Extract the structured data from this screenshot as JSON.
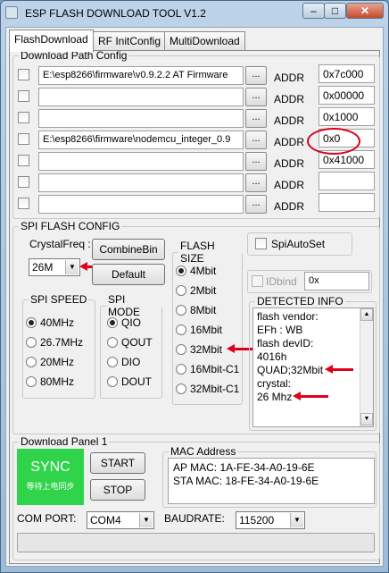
{
  "window": {
    "title": "ESP FLASH DOWNLOAD TOOL V1.2",
    "minimize": "–",
    "maximize": "□",
    "close": "✕"
  },
  "tabs": [
    {
      "label": "FlashDownload",
      "active": true
    },
    {
      "label": "RF InitConfig",
      "active": false
    },
    {
      "label": "MultiDownload",
      "active": false
    }
  ],
  "download_path_config": {
    "legend": "Download Path Config",
    "browse_label": "...",
    "addr_label": "ADDR",
    "rows": [
      {
        "checked": false,
        "path": "E:\\esp8266\\firmware\\v0.9.2.2 AT Firmware",
        "addr": "0x7c000"
      },
      {
        "checked": false,
        "path": "",
        "addr": "0x00000"
      },
      {
        "checked": false,
        "path": "",
        "addr": "0x1000"
      },
      {
        "checked": false,
        "path": "E:\\esp8266\\firmware\\nodemcu_integer_0.9",
        "addr": "0x0"
      },
      {
        "checked": false,
        "path": "",
        "addr": "0x41000"
      },
      {
        "checked": false,
        "path": "",
        "addr": ""
      },
      {
        "checked": false,
        "path": "",
        "addr": ""
      }
    ]
  },
  "spi_flash_config": {
    "legend": "SPI FLASH CONFIG",
    "crystal_label": "CrystalFreq :",
    "crystal_value": "26M",
    "combine_button": "CombineBin",
    "default_button": "Default",
    "spi_auto_set": "SpiAutoSet",
    "idbind_label": "IDbind",
    "idbind_value": "0x",
    "spi_speed": {
      "legend": "SPI SPEED",
      "options": [
        "40MHz",
        "26.7MHz",
        "20MHz",
        "80MHz"
      ],
      "selected": 0
    },
    "spi_mode": {
      "legend": "SPI MODE",
      "options": [
        "QIO",
        "QOUT",
        "DIO",
        "DOUT"
      ],
      "selected": 0
    },
    "flash_size": {
      "legend": "FLASH SIZE",
      "options": [
        "4Mbit",
        "2Mbit",
        "8Mbit",
        "16Mbit",
        "32Mbit",
        "16Mbit-C1",
        "32Mbit-C1"
      ],
      "selected": 0
    },
    "detected_info": {
      "legend": "DETECTED INFO",
      "lines": [
        "flash vendor:",
        "EFh : WB",
        "flash devID:",
        "4016h",
        "QUAD;32Mbit",
        "crystal:",
        "26 Mhz"
      ]
    }
  },
  "download_panel": {
    "legend": "Download Panel 1",
    "sync_label": "SYNC",
    "sync_sub": "等待上电同步",
    "start_button": "START",
    "stop_button": "STOP",
    "mac_legend": "MAC Address",
    "ap_mac": "AP  MAC:  1A-FE-34-A0-19-6E",
    "sta_mac": "STA MAC:  18-FE-34-A0-19-6E",
    "com_port_label": "COM PORT:",
    "com_port_value": "COM4",
    "baud_label": "BAUDRATE:",
    "baud_value": "115200"
  },
  "colors": {
    "sync_green": "#2fd44a",
    "annotation_red": "#e0001a",
    "title_bar": "#bcd3e8"
  }
}
